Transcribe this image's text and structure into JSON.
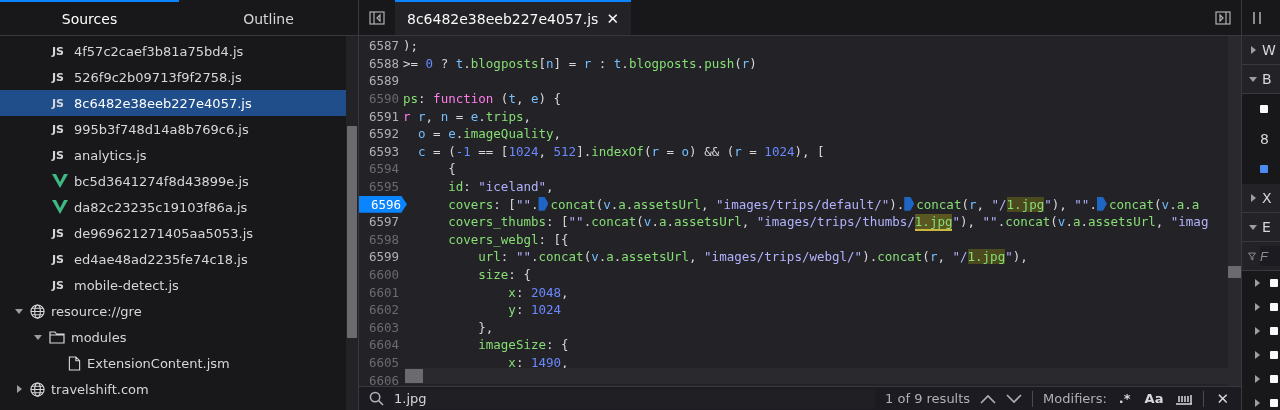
{
  "sidebar": {
    "tabs": [
      {
        "label": "Sources",
        "selected": true
      },
      {
        "label": "Outline",
        "selected": false
      }
    ],
    "tree": [
      {
        "children": [
          {
            "children": [
              {
                "kind": "js",
                "icon_label": "JS",
                "label": "4f57c2caef3b81a75bd4.js",
                "selected": false
              },
              {
                "kind": "js",
                "icon_label": "JS",
                "label": "526f9c2b09713f9f2758.js",
                "selected": false
              },
              {
                "kind": "js",
                "icon_label": "JS",
                "label": "8c6482e38eeb227e4057.js",
                "selected": true
              },
              {
                "kind": "js",
                "icon_label": "JS",
                "label": "995b3f748d14a8b769c6.js",
                "selected": false
              },
              {
                "kind": "js",
                "icon_label": "JS",
                "label": "analytics.js",
                "selected": false
              },
              {
                "kind": "vue",
                "label": "bc5d3641274f8d43899e.js",
                "selected": false
              },
              {
                "kind": "vue",
                "label": "da82c23235c19103f86a.js",
                "selected": false
              },
              {
                "kind": "js",
                "icon_label": "JS",
                "label": "de969621271405aa5053.js",
                "selected": false
              },
              {
                "kind": "js",
                "icon_label": "JS",
                "label": "ed4ae48ad2235fe74c18.js",
                "selected": false
              },
              {
                "kind": "js",
                "icon_label": "JS",
                "label": "mobile-detect.js",
                "selected": false
              }
            ]
          }
        ]
      },
      {
        "kind": "domain",
        "label": "resource://gre",
        "selected": false,
        "expanded": true,
        "children": [
          {
            "kind": "folder",
            "label": "modules",
            "selected": false,
            "expanded": true,
            "children": [
              {
                "kind": "file",
                "label": "ExtensionContent.jsm",
                "selected": false
              }
            ]
          }
        ]
      },
      {
        "kind": "domain",
        "label": "travelshift.com",
        "selected": false,
        "expanded": false
      }
    ]
  },
  "editor": {
    "tab": {
      "label": "8c6482e38eeb227e4057.js",
      "close": "✕"
    },
    "lines": [
      {
        "number": "6587",
        "breakable": true,
        "breakpoint": false,
        "tokens": [
          {
            "text": ");",
            "kind": "punct"
          }
        ]
      },
      {
        "number": "6588",
        "breakable": true,
        "breakpoint": false,
        "tokens": [
          {
            "text": ">=",
            "kind": "punct"
          },
          {
            "text": " 0",
            "kind": "number"
          },
          {
            "text": " ?",
            "kind": "punct"
          },
          {
            "text": " t",
            "kind": "variable"
          },
          {
            "text": ".",
            "kind": "punct"
          },
          {
            "text": "blogposts",
            "kind": "property"
          },
          {
            "text": "[",
            "kind": "punct"
          },
          {
            "text": "n",
            "kind": "variable"
          },
          {
            "text": "] =",
            "kind": "punct"
          },
          {
            "text": " r",
            "kind": "variable"
          },
          {
            "text": " :",
            "kind": "punct"
          },
          {
            "text": " t",
            "kind": "variable"
          },
          {
            "text": ".",
            "kind": "punct"
          },
          {
            "text": "blogposts",
            "kind": "property"
          },
          {
            "text": ".",
            "kind": "punct"
          },
          {
            "text": "push",
            "kind": "property"
          },
          {
            "text": "(",
            "kind": "punct"
          },
          {
            "text": "r",
            "kind": "variable"
          },
          {
            "text": ")",
            "kind": "punct"
          }
        ]
      },
      {
        "number": "6589",
        "breakable": true,
        "breakpoint": false
      },
      {
        "number": "6590",
        "breakable": false,
        "breakpoint": false,
        "tokens": [
          {
            "text": "ps",
            "kind": "property"
          },
          {
            "text": ":",
            "kind": "punct"
          },
          {
            "text": " function",
            "kind": "keyword"
          },
          {
            "text": " (",
            "kind": "punct"
          },
          {
            "text": "t",
            "kind": "variable"
          },
          {
            "text": ",",
            "kind": "punct"
          },
          {
            "text": " e",
            "kind": "variable"
          },
          {
            "text": ") {",
            "kind": "punct"
          }
        ]
      },
      {
        "number": "6591",
        "breakable": true,
        "breakpoint": false,
        "tokens": [
          {
            "text": "r",
            "kind": "keyword"
          },
          {
            "text": " r",
            "kind": "variable"
          },
          {
            "text": ",",
            "kind": "punct"
          },
          {
            "text": " n",
            "kind": "variable"
          },
          {
            "text": " =",
            "kind": "punct"
          },
          {
            "text": " e",
            "kind": "variable"
          },
          {
            "text": ".",
            "kind": "punct"
          },
          {
            "text": "trips",
            "kind": "property"
          },
          {
            "text": ",",
            "kind": "punct"
          }
        ]
      },
      {
        "number": "6592",
        "breakable": true,
        "breakpoint": false,
        "tokens": [
          {
            "text": "  o",
            "kind": "variable"
          },
          {
            "text": " =",
            "kind": "punct"
          },
          {
            "text": " e",
            "kind": "variable"
          },
          {
            "text": ".",
            "kind": "punct"
          },
          {
            "text": "imageQuality",
            "kind": "property"
          },
          {
            "text": ",",
            "kind": "punct"
          }
        ]
      },
      {
        "number": "6593",
        "breakable": true,
        "breakpoint": false,
        "tokens": [
          {
            "text": "  c",
            "kind": "variable"
          },
          {
            "text": " = (",
            "kind": "punct"
          },
          {
            "text": "-1",
            "kind": "number"
          },
          {
            "text": " == [",
            "kind": "punct"
          },
          {
            "text": "1024",
            "kind": "number"
          },
          {
            "text": ",",
            "kind": "punct"
          },
          {
            "text": " 512",
            "kind": "number"
          },
          {
            "text": "].",
            "kind": "punct"
          },
          {
            "text": "indexOf",
            "kind": "property"
          },
          {
            "text": "(",
            "kind": "punct"
          },
          {
            "text": "r",
            "kind": "variable"
          },
          {
            "text": " =",
            "kind": "punct"
          },
          {
            "text": " o",
            "kind": "variable"
          },
          {
            "text": ") && (",
            "kind": "punct"
          },
          {
            "text": "r",
            "kind": "variable"
          },
          {
            "text": " =",
            "kind": "punct"
          },
          {
            "text": " 1024",
            "kind": "number"
          },
          {
            "text": "), [",
            "kind": "punct"
          }
        ]
      },
      {
        "number": "6594",
        "breakable": false,
        "breakpoint": false,
        "tokens": [
          {
            "text": "      {",
            "kind": "punct"
          }
        ]
      },
      {
        "number": "6595",
        "breakable": false,
        "breakpoint": false,
        "tokens": [
          {
            "text": "      id",
            "kind": "property"
          },
          {
            "text": ":",
            "kind": "punct"
          },
          {
            "text": " \"iceland\"",
            "kind": "string"
          },
          {
            "text": ",",
            "kind": "punct"
          }
        ]
      },
      {
        "number": "6596",
        "breakable": true,
        "breakpoint": true,
        "tokens": [
          {
            "text": "      covers",
            "kind": "property"
          },
          {
            "text": ": [",
            "kind": "punct"
          },
          {
            "text": "\"\"",
            "kind": "string"
          },
          {
            "text": ".",
            "kind": "punct"
          },
          {
            "text": "concat",
            "kind": "column-breakpoint"
          },
          {
            "text": "(",
            "kind": "punct"
          },
          {
            "text": "v",
            "kind": "variable"
          },
          {
            "text": ".",
            "kind": "punct"
          },
          {
            "text": "a",
            "kind": "property"
          },
          {
            "text": ".",
            "kind": "punct"
          },
          {
            "text": "assetsUrl",
            "kind": "property"
          },
          {
            "text": ",",
            "kind": "punct"
          },
          {
            "text": " \"images/trips/default/\"",
            "kind": "string"
          },
          {
            "text": ").",
            "kind": "punct"
          },
          {
            "text": "concat",
            "kind": "column-breakpoint"
          },
          {
            "text": "(",
            "kind": "punct"
          },
          {
            "text": "r",
            "kind": "variable"
          },
          {
            "text": ",",
            "kind": "punct"
          },
          {
            "text": " \"/",
            "kind": "string"
          },
          {
            "text": "1.jpg",
            "kind": "match"
          },
          {
            "text": "\"",
            "kind": "string"
          },
          {
            "text": "),",
            "kind": "punct"
          },
          {
            "text": " \"\"",
            "kind": "string"
          },
          {
            "text": ".",
            "kind": "punct"
          },
          {
            "text": "concat",
            "kind": "column-breakpoint"
          },
          {
            "text": "(",
            "kind": "punct"
          },
          {
            "text": "v",
            "kind": "variable"
          },
          {
            "text": ".",
            "kind": "punct"
          },
          {
            "text": "a",
            "kind": "property"
          },
          {
            "text": ".",
            "kind": "punct"
          },
          {
            "text": "a",
            "kind": "property"
          }
        ]
      },
      {
        "number": "6597",
        "breakable": true,
        "breakpoint": false,
        "tokens": [
          {
            "text": "      covers_thumbs",
            "kind": "property"
          },
          {
            "text": ": [",
            "kind": "punct"
          },
          {
            "text": "\"\"",
            "kind": "string"
          },
          {
            "text": ".",
            "kind": "punct"
          },
          {
            "text": "concat",
            "kind": "property"
          },
          {
            "text": "(",
            "kind": "punct"
          },
          {
            "text": "v",
            "kind": "variable"
          },
          {
            "text": ".",
            "kind": "punct"
          },
          {
            "text": "a",
            "kind": "property"
          },
          {
            "text": ".",
            "kind": "punct"
          },
          {
            "text": "assetsUrl",
            "kind": "property"
          },
          {
            "text": ",",
            "kind": "punct"
          },
          {
            "text": " \"images/trips/thumbs/",
            "kind": "string"
          },
          {
            "text": "1.jpg",
            "kind": "current-match"
          },
          {
            "text": "\"",
            "kind": "string"
          },
          {
            "text": "),",
            "kind": "punct"
          },
          {
            "text": " \"\"",
            "kind": "string"
          },
          {
            "text": ".",
            "kind": "punct"
          },
          {
            "text": "concat",
            "kind": "property"
          },
          {
            "text": "(",
            "kind": "punct"
          },
          {
            "text": "v",
            "kind": "variable"
          },
          {
            "text": ".",
            "kind": "punct"
          },
          {
            "text": "a",
            "kind": "property"
          },
          {
            "text": ".",
            "kind": "punct"
          },
          {
            "text": "assetsUrl",
            "kind": "property"
          },
          {
            "text": ",",
            "kind": "punct"
          },
          {
            "text": " \"imag",
            "kind": "string"
          }
        ]
      },
      {
        "number": "6598",
        "breakable": false,
        "breakpoint": false,
        "tokens": [
          {
            "text": "      covers_webgl",
            "kind": "property"
          },
          {
            "text": ": [{",
            "kind": "punct"
          }
        ]
      },
      {
        "number": "6599",
        "breakable": true,
        "breakpoint": false,
        "tokens": [
          {
            "text": "          url",
            "kind": "property"
          },
          {
            "text": ":",
            "kind": "punct"
          },
          {
            "text": " \"\"",
            "kind": "string"
          },
          {
            "text": ".",
            "kind": "punct"
          },
          {
            "text": "concat",
            "kind": "property"
          },
          {
            "text": "(",
            "kind": "punct"
          },
          {
            "text": "v",
            "kind": "variable"
          },
          {
            "text": ".",
            "kind": "punct"
          },
          {
            "text": "a",
            "kind": "property"
          },
          {
            "text": ".",
            "kind": "punct"
          },
          {
            "text": "assetsUrl",
            "kind": "property"
          },
          {
            "text": ",",
            "kind": "punct"
          },
          {
            "text": " \"images/trips/webgl/\"",
            "kind": "string"
          },
          {
            "text": ").",
            "kind": "punct"
          },
          {
            "text": "concat",
            "kind": "property"
          },
          {
            "text": "(",
            "kind": "punct"
          },
          {
            "text": "r",
            "kind": "variable"
          },
          {
            "text": ",",
            "kind": "punct"
          },
          {
            "text": " \"/",
            "kind": "string"
          },
          {
            "text": "1.jpg",
            "kind": "match"
          },
          {
            "text": "\"",
            "kind": "string"
          },
          {
            "text": "),",
            "kind": "punct"
          }
        ]
      },
      {
        "number": "6600",
        "breakable": false,
        "breakpoint": false,
        "tokens": [
          {
            "text": "          size",
            "kind": "property"
          },
          {
            "text": ": {",
            "kind": "punct"
          }
        ]
      },
      {
        "number": "6601",
        "breakable": false,
        "breakpoint": false,
        "tokens": [
          {
            "text": "              x",
            "kind": "property"
          },
          {
            "text": ":",
            "kind": "punct"
          },
          {
            "text": " 2048",
            "kind": "number"
          },
          {
            "text": ",",
            "kind": "punct"
          }
        ]
      },
      {
        "number": "6602",
        "breakable": false,
        "breakpoint": false,
        "tokens": [
          {
            "text": "              y",
            "kind": "property"
          },
          {
            "text": ":",
            "kind": "punct"
          },
          {
            "text": " 1024",
            "kind": "number"
          }
        ]
      },
      {
        "number": "6603",
        "breakable": false,
        "breakpoint": false,
        "tokens": [
          {
            "text": "          },",
            "kind": "punct"
          }
        ]
      },
      {
        "number": "6604",
        "breakable": false,
        "breakpoint": false,
        "tokens": [
          {
            "text": "          imageSize",
            "kind": "property"
          },
          {
            "text": ": {",
            "kind": "punct"
          }
        ]
      },
      {
        "number": "6605",
        "breakable": false,
        "breakpoint": false,
        "tokens": [
          {
            "text": "              x",
            "kind": "property"
          },
          {
            "text": ":",
            "kind": "punct"
          },
          {
            "text": " 1490",
            "kind": "number"
          },
          {
            "text": ",",
            "kind": "punct"
          }
        ]
      },
      {
        "number": "6606",
        "breakable": false,
        "breakpoint": false
      }
    ]
  },
  "search_bar": {
    "value": "1.jpg",
    "results": "1 of 9 results",
    "modifiers_label": "Modifiers:",
    "regex": ".*",
    "match_case": "Aa",
    "close": "✕"
  },
  "right_panel": {
    "rows": [
      {
        "kind": "section",
        "label": "W",
        "expanded": false
      },
      {
        "kind": "section",
        "label": "B",
        "expanded": true
      },
      {
        "kind": "check",
        "checked": false
      },
      {
        "kind": "text",
        "label": "8"
      },
      {
        "kind": "check",
        "checked": true
      },
      {
        "kind": "section",
        "label": "X",
        "expanded": false
      },
      {
        "kind": "section",
        "label": "E",
        "expanded": true
      },
      {
        "kind": "filter",
        "placeholder": "F"
      },
      {
        "kind": "item",
        "checked": false
      },
      {
        "kind": "item",
        "checked": false
      },
      {
        "kind": "item",
        "checked": false
      },
      {
        "kind": "item",
        "checked": false
      },
      {
        "kind": "item",
        "checked": false
      },
      {
        "kind": "item",
        "checked": false
      }
    ]
  }
}
